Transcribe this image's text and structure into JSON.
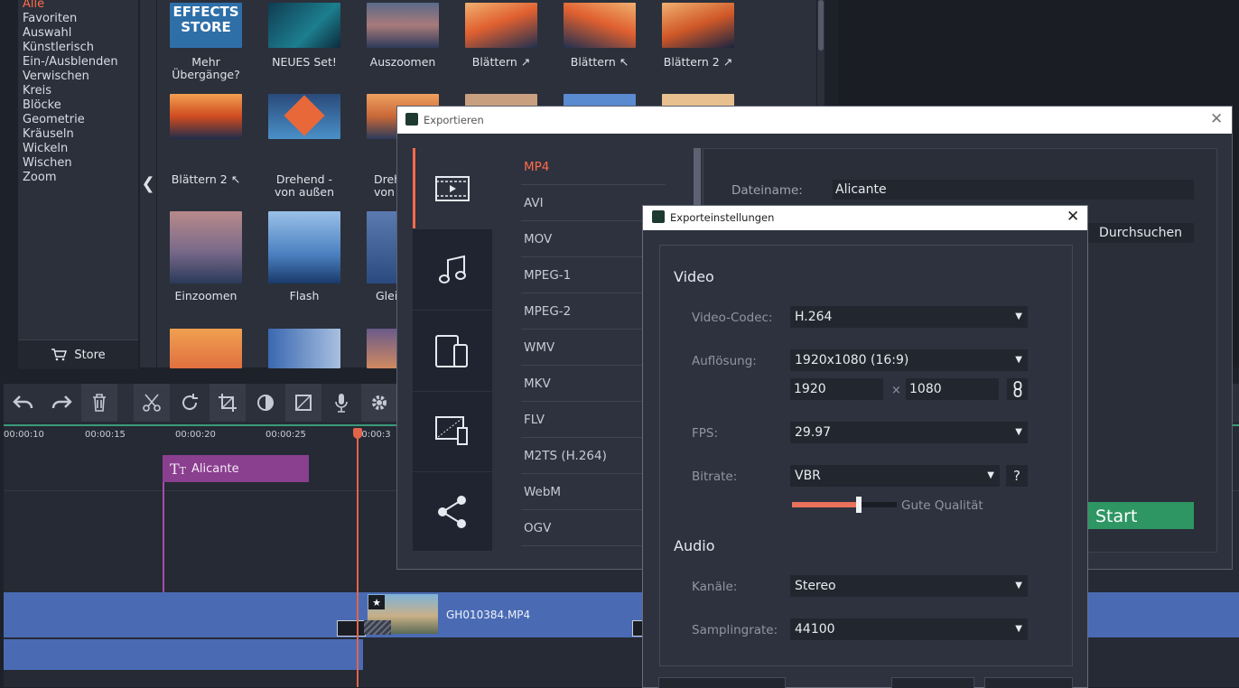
{
  "categories": {
    "items": [
      "Alle",
      "Favoriten",
      "Auswahl",
      "Künstlerisch",
      "Ein-/Ausblenden",
      "Verwischen",
      "Kreis",
      "Blöcke",
      "Geometrie",
      "Kräuseln",
      "Wickeln",
      "Wischen",
      "Zoom"
    ],
    "active": "Alle",
    "store_label": "Store",
    "collapse_glyph": "❮"
  },
  "transitions": {
    "effects_store_line1": "EFFECTS",
    "effects_store_line2": "STORE",
    "labels": [
      "Mehr\nÜbergänge?",
      "NEUES Set!",
      "Auszoomen",
      "Blättern ↗",
      "Blättern ↖",
      "Blättern 2 ↗",
      "Blättern 2 ↖",
      "Drehend -\nvon außen",
      "Dreh\nvon",
      "Einzoomen",
      "Flash",
      "Glei"
    ]
  },
  "toolbar": {
    "icons": [
      "undo-icon",
      "redo-icon",
      "trash-icon",
      "scissors-icon",
      "rotate-icon",
      "crop-icon",
      "color-icon",
      "stabilize-icon",
      "mic-icon",
      "gear-icon"
    ]
  },
  "timeline": {
    "ticks": [
      "00:00:10",
      "00:00:15",
      "00:00:20",
      "00:00:25",
      "00:00:3"
    ],
    "title_clip": "Alicante",
    "video_clip": "GH010384.MP4"
  },
  "export": {
    "title": "Exportieren",
    "formats": [
      "MP4",
      "AVI",
      "MOV",
      "MPEG-1",
      "MPEG-2",
      "WMV",
      "MKV",
      "FLV",
      "M2TS (H.264)",
      "WebM",
      "OGV"
    ],
    "active_format": "MP4",
    "filename_label": "Dateiname:",
    "filename_value": "Alicante",
    "browse_label": "Durchsuchen",
    "start_label": "Start"
  },
  "settings": {
    "title": "Exporteinstellungen",
    "video_section": "Video",
    "codec_label": "Video-Codec:",
    "codec_value": "H.264",
    "res_label": "Auflösung:",
    "res_value": "1920x1080 (16:9)",
    "width_value": "1920",
    "height_value": "1080",
    "cross": "×",
    "fps_label": "FPS:",
    "fps_value": "29.97",
    "bitrate_label": "Bitrate:",
    "bitrate_value": "VBR",
    "help": "?",
    "quality_label": "Gute Qualität",
    "quality_level": 0.64,
    "audio_section": "Audio",
    "channels_label": "Kanäle:",
    "channels_value": "Stereo",
    "sample_label": "Samplingrate:",
    "sample_value": "44100"
  }
}
